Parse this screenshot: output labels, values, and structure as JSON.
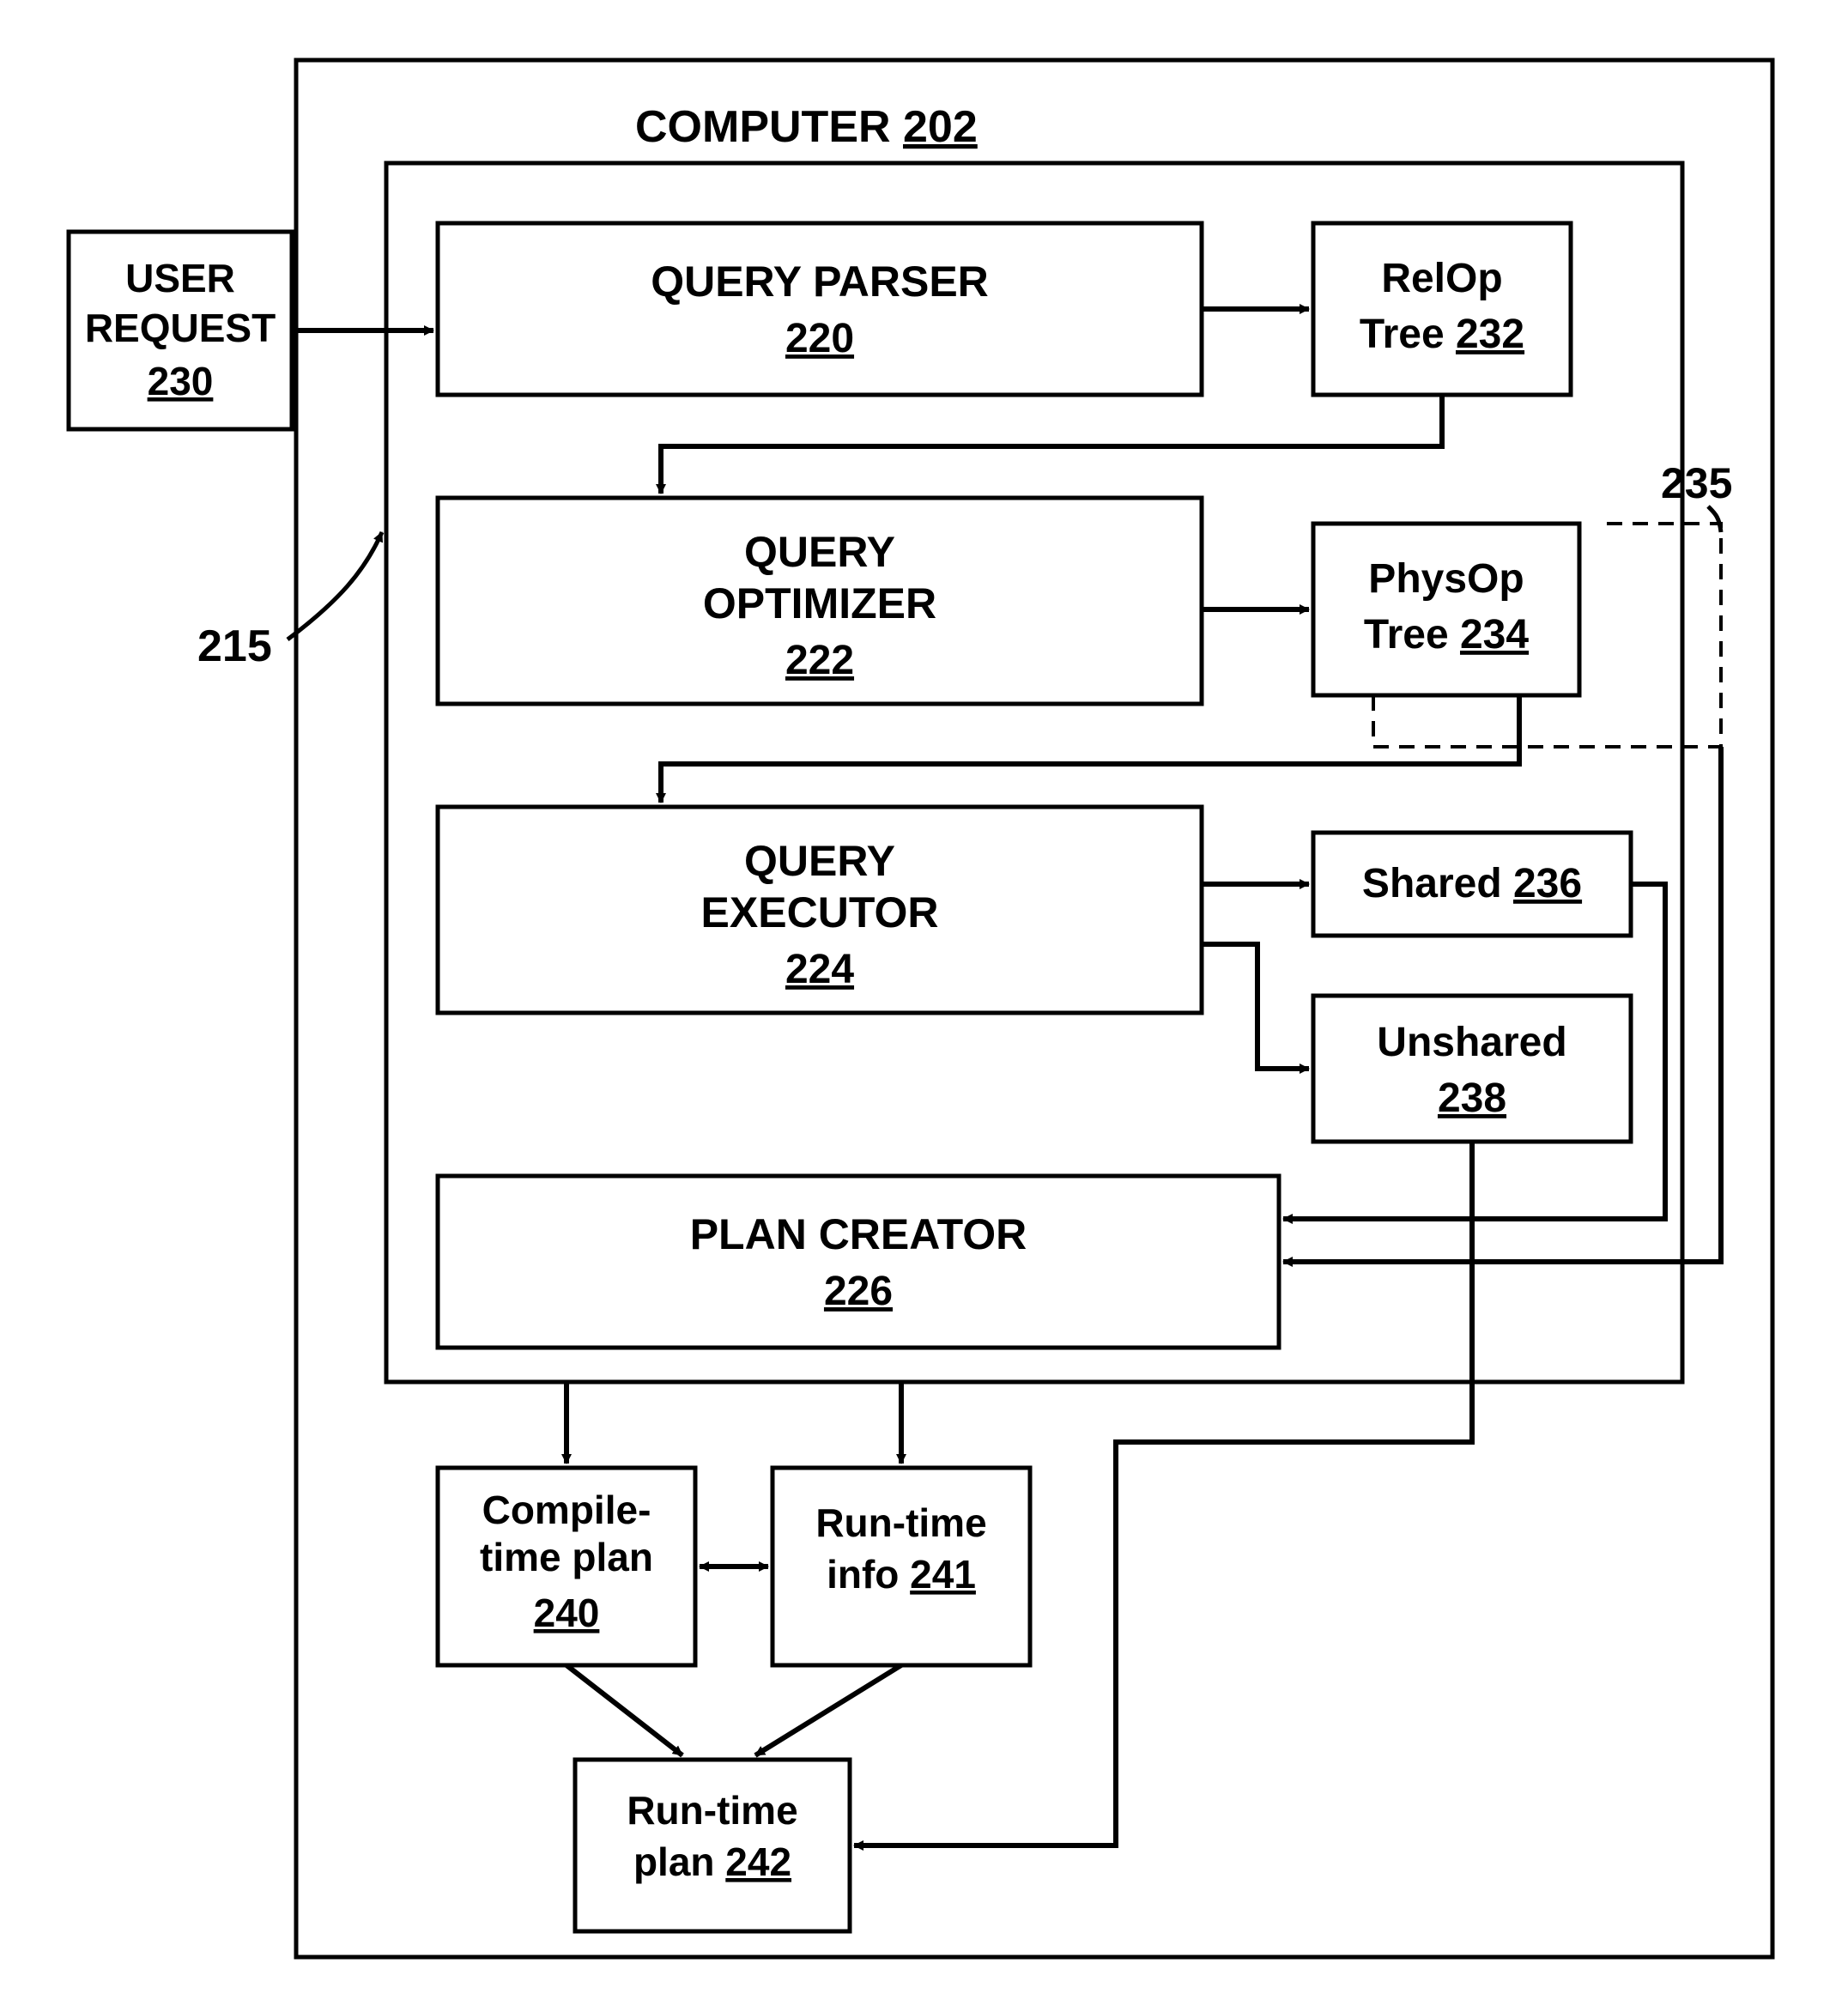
{
  "outer": {
    "computer_label": "COMPUTER",
    "computer_ref": "202",
    "ref215": "215",
    "ref235": "235"
  },
  "user_request": {
    "line1": "USER",
    "line2": "REQUEST",
    "ref": "230"
  },
  "query_parser": {
    "title": "QUERY PARSER",
    "ref": "220"
  },
  "query_optimizer": {
    "line1": "QUERY",
    "line2": "OPTIMIZER",
    "ref": "222"
  },
  "query_executor": {
    "line1": "QUERY",
    "line2": "EXECUTOR",
    "ref": "224"
  },
  "plan_creator": {
    "title": "PLAN CREATOR",
    "ref": "226"
  },
  "relop": {
    "line1": "RelOp",
    "line2pre": "Tree ",
    "ref": "232"
  },
  "physop": {
    "line1": "PhysOp",
    "line2pre": "Tree ",
    "ref": "234"
  },
  "shared": {
    "label": "Shared ",
    "ref": "236"
  },
  "unshared": {
    "label": "Unshared",
    "ref": "238"
  },
  "compile": {
    "line1": "Compile-",
    "line2": "time plan",
    "ref": "240"
  },
  "runinfo": {
    "line1": "Run-time",
    "line2pre": "info ",
    "ref": "241"
  },
  "runplan": {
    "line1": "Run-time",
    "line2pre": "plan ",
    "ref": "242"
  }
}
